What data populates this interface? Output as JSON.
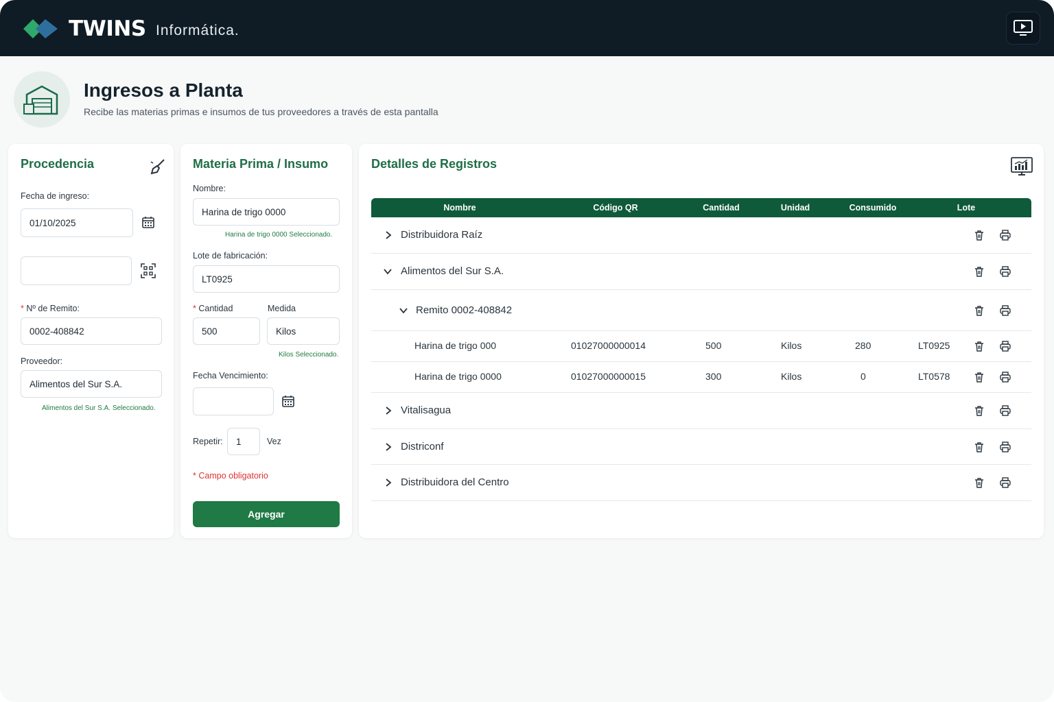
{
  "brand": {
    "name": "TWINS",
    "suffix": "Informática."
  },
  "header": {
    "title": "Ingresos a Planta",
    "subtitle": "Recibe las materias primas e insumos de tus proveedores a través de esta pantalla"
  },
  "procedencia": {
    "title": "Procedencia",
    "fecha_label": "Fecha de ingreso:",
    "fecha_value": "01/10/2025",
    "qr_value": "",
    "remito_req": "*",
    "remito_label": "Nº de Remito:",
    "remito_value": "0002-408842",
    "proveedor_label": "Proveedor:",
    "proveedor_value": "Alimentos del Sur S.A.",
    "proveedor_hint": "Alimentos del Sur S.A. Seleccionado."
  },
  "materia": {
    "title": "Materia Prima / Insumo",
    "nombre_label": "Nombre:",
    "nombre_value": "Harina de trigo 0000",
    "nombre_hint": "Harina de trigo 0000 Seleccionado.",
    "lote_label": "Lote de fabricación:",
    "lote_value": "LT0925",
    "cantidad_req": "*",
    "cantidad_label": "Cantidad",
    "cantidad_value": "500",
    "medida_label": "Medida",
    "medida_value": "Kilos",
    "medida_hint": "Kilos Seleccionado.",
    "venc_label": "Fecha Vencimiento:",
    "venc_value": "",
    "repetir_label": "Repetir:",
    "repetir_value": "1",
    "repetir_unit": "Vez",
    "obligatorio_req": "*",
    "obligatorio": "Campo obligatorio",
    "agregar": "Agregar"
  },
  "detalles": {
    "title": "Detalles de Registros",
    "columns": [
      "Nombre",
      "Código QR",
      "Cantidad",
      "Unidad",
      "Consumido",
      "Lote"
    ],
    "rows": [
      {
        "name": "Distribuidora Raíz",
        "expanded": false
      },
      {
        "name": "Alimentos del Sur S.A.",
        "expanded": true
      },
      {
        "name": "Remito 0002-408842",
        "expanded": true
      },
      {
        "name": "Harina de trigo 000",
        "qr": "01027000000014",
        "cantidad": "500",
        "unidad": "Kilos",
        "consumido": "280",
        "lote": "LT0925"
      },
      {
        "name": "Harina de trigo 0000",
        "qr": "01027000000015",
        "cantidad": "300",
        "unidad": "Kilos",
        "consumido": "0",
        "lote": "LT0578"
      },
      {
        "name": "Vitalisagua",
        "expanded": false
      },
      {
        "name": "Districonf",
        "expanded": false
      },
      {
        "name": "Distribuidora del Centro",
        "expanded": false
      }
    ]
  },
  "colors": {
    "brand_dark": "#0f1c26",
    "accent_green": "#1f7a45",
    "table_header": "#0f5a3a",
    "required": "#dd3333"
  },
  "icons": [
    "logo-diamond-icon",
    "screen-play-icon",
    "warehouse-icon",
    "broom-icon",
    "calendar-icon",
    "qr-scan-icon",
    "chart-icon",
    "chevron-right-icon",
    "chevron-down-icon",
    "trash-icon",
    "printer-icon"
  ]
}
